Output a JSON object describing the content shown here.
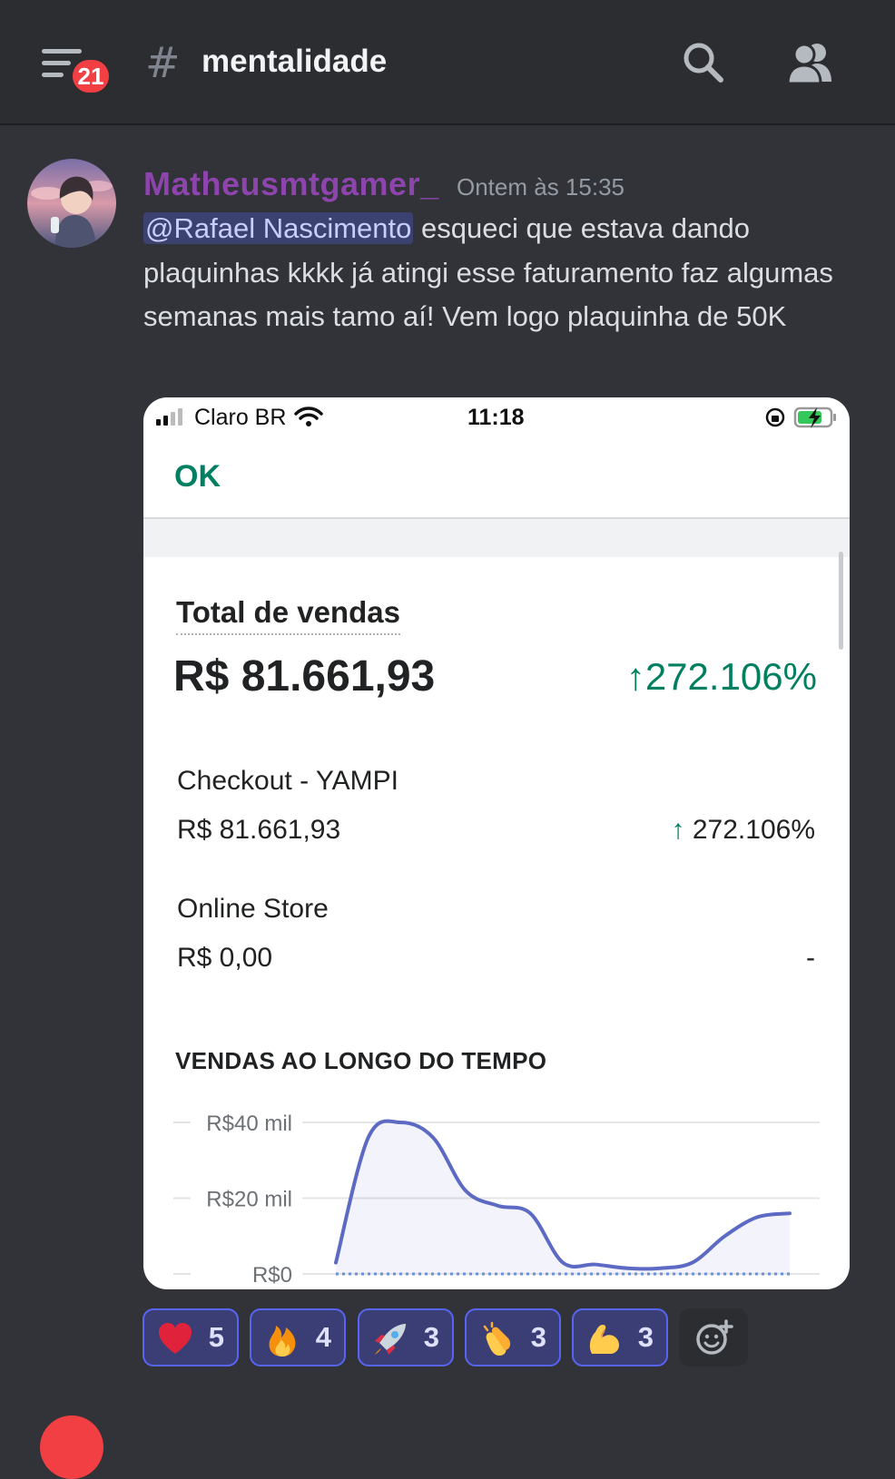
{
  "header": {
    "notification_count": "21",
    "channel_hash": "#",
    "channel_name": "mentalidade"
  },
  "message": {
    "author": "Matheusmtgamer_",
    "timestamp": "Ontem às 15:35",
    "mention": "@Rafael Nascimento",
    "text": " esqueci que estava dando plaquinhas kkkk já atingi esse faturamento faz algumas semanas mais tamo aí! Vem logo plaquinha de 50K"
  },
  "attachment": {
    "status_bar": {
      "carrier": "Claro BR",
      "time": "11:18"
    },
    "ok_label": "OK",
    "total_label": "Total de vendas",
    "total_value": "R$ 81.661,93",
    "total_change": "272.106%",
    "rows": [
      {
        "label": "Checkout - YAMPI",
        "value": "R$ 81.661,93",
        "change": "272.106%"
      },
      {
        "label": "Online Store",
        "value": "R$ 0,00",
        "change": "-"
      }
    ],
    "chart_title": "VENDAS AO LONGO DO TEMPO"
  },
  "chart_data": {
    "type": "line",
    "title": "VENDAS AO LONGO DO TEMPO",
    "y_ticks": [
      "R$40 mil",
      "R$20 mil",
      "R$0"
    ],
    "ylim": [
      0,
      40000
    ],
    "grid": true,
    "series": [
      {
        "values": [
          3000,
          36000,
          40000,
          36000,
          22000,
          18000,
          16000,
          3000,
          2500,
          1500,
          1500,
          3000,
          10000,
          15000,
          16000
        ]
      },
      {
        "values": [
          0,
          0,
          0,
          0,
          0,
          0,
          0,
          0,
          0,
          0,
          0,
          0,
          0,
          0,
          0
        ]
      }
    ],
    "colors": {
      "current": "#5c6ac4",
      "previous": "#6b8fd6"
    }
  },
  "reactions": [
    {
      "emoji": "heart-icon",
      "count": "5"
    },
    {
      "emoji": "fire-icon",
      "count": "4"
    },
    {
      "emoji": "rocket-icon",
      "count": "3"
    },
    {
      "emoji": "clap-icon",
      "count": "3"
    },
    {
      "emoji": "flexed-biceps-icon",
      "count": "3"
    }
  ],
  "colors": {
    "background": "#313338",
    "header": "#2b2d31",
    "author": "#8e44ad",
    "mention_bg": "#3c4270",
    "reaction_bg": "#3b3e75",
    "reaction_border": "#5865f2",
    "shopify_green": "#008060"
  }
}
